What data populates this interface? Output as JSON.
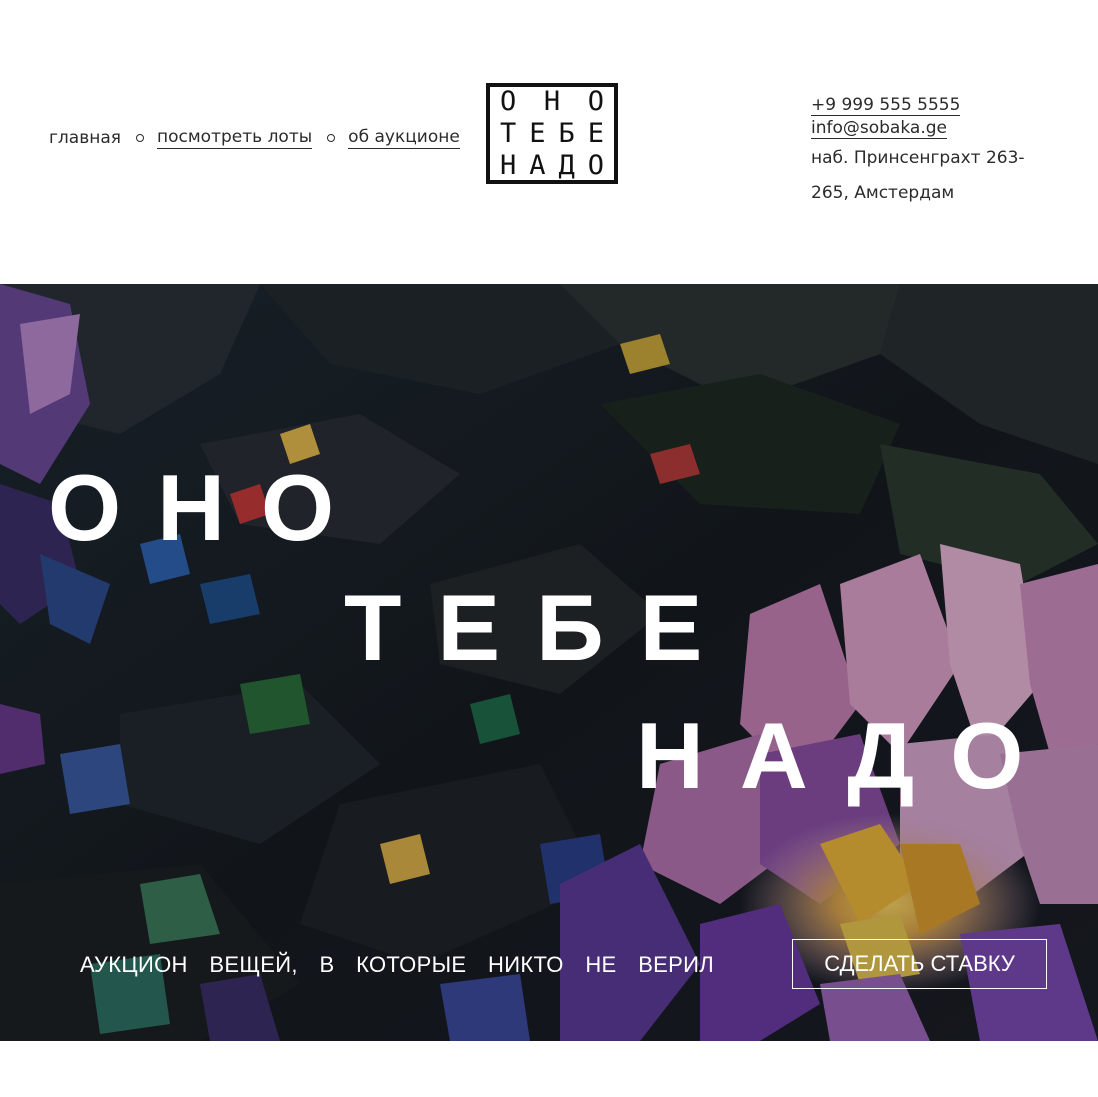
{
  "nav": {
    "items": [
      {
        "label": "главная"
      },
      {
        "label": "посмотреть лоты"
      },
      {
        "label": "об аукционе"
      }
    ]
  },
  "logo": {
    "rows": [
      [
        "О",
        "Н",
        "О"
      ],
      [
        "Т",
        "Е",
        "Б",
        "Е"
      ],
      [
        "Н",
        "А",
        "Д",
        "О"
      ]
    ]
  },
  "contacts": {
    "phone": "+9 999 555 5555",
    "email": "info@sobaka.ge",
    "address_line1": "наб. Принсенграхт 263-",
    "address_line2": "265, Амстердам"
  },
  "hero": {
    "title_line1": "ОНО",
    "title_line2": "ТЕБЕ",
    "title_line3": "НАДО",
    "tagline_words": [
      "АУКЦИОН",
      "ВЕЩЕЙ,",
      "В",
      "КОТОРЫЕ",
      "НИКТО",
      "НЕ",
      "ВЕРИЛ"
    ],
    "button_label": "СДЕЛАТЬ СТАВКУ"
  },
  "colors": {
    "text": "#2b2b2b",
    "hero_text": "#ffffff",
    "hero_bg": "#1c2229",
    "petal_pink": "#d79bc4",
    "petal_violet": "#6a3aa0",
    "flower_yellow": "#e8b43a"
  }
}
